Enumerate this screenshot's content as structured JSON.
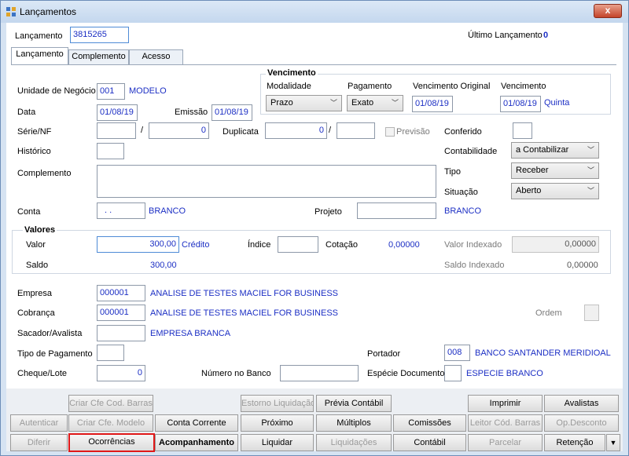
{
  "window": {
    "title": "Lançamentos",
    "close_label": "x"
  },
  "header": {
    "lancamento_label": "Lançamento",
    "lancamento_value": "3815265",
    "ultimo_label": "Último Lançamento",
    "ultimo_value": "0"
  },
  "tabs": [
    "Lançamento",
    "Complemento",
    "Acesso"
  ],
  "form": {
    "unidade_label": "Unidade de Negócio",
    "unidade_code": "001",
    "unidade_name": "MODELO",
    "data_label": "Data",
    "data_value": "01/08/19",
    "emissao_label": "Emissão",
    "emissao_value": "01/08/19",
    "serie_label": "Série/NF",
    "slash": "/",
    "serie_num": "0",
    "duplicata_label": "Duplicata",
    "duplicata_value": "0",
    "previsao_label": "Previsão",
    "historico_label": "Histórico",
    "complemento_label": "Complemento",
    "conta_label": "Conta",
    "conta_value": ". .",
    "conta_name": "BRANCO",
    "projeto_label": "Projeto",
    "projeto_name": "BRANCO"
  },
  "vencimento": {
    "title": "Vencimento",
    "modalidade_label": "Modalidade",
    "modalidade_value": "Prazo",
    "pagamento_label": "Pagamento",
    "pagamento_value": "Exato",
    "venc_original_label": "Vencimento Original",
    "venc_original_value": "01/08/19",
    "venc_label": "Vencimento",
    "venc_value": "01/08/19",
    "venc_day": "Quinta"
  },
  "right": {
    "conferido_label": "Conferido",
    "contabilidade_label": "Contabilidade",
    "contabilidade_value": "a Contabilizar",
    "tipo_label": "Tipo",
    "tipo_value": "Receber",
    "situacao_label": "Situação",
    "situacao_value": "Aberto"
  },
  "valores": {
    "title": "Valores",
    "valor_label": "Valor",
    "valor_value": "300,00",
    "valor_tipo": "Crédito",
    "indice_label": "Índice",
    "cotacao_label": "Cotação",
    "cotacao_value": "0,00000",
    "valor_indexado_label": "Valor Indexado",
    "valor_indexado_value": "0,00000",
    "saldo_label": "Saldo",
    "saldo_value": "300,00",
    "saldo_indexado_label": "Saldo Indexado",
    "saldo_indexado_value": "0,00000"
  },
  "bottom": {
    "empresa_label": "Empresa",
    "empresa_code": "000001",
    "empresa_name": "ANALISE DE TESTES MACIEL FOR BUSINESS",
    "cobranca_label": "Cobrança",
    "cobranca_code": "000001",
    "cobranca_name": "ANALISE DE TESTES MACIEL FOR BUSINESS",
    "ordem_label": "Ordem",
    "sacador_label": "Sacador/Avalista",
    "sacador_name": "EMPRESA BRANCA",
    "tipo_pag_label": "Tipo de Pagamento",
    "portador_label": "Portador",
    "portador_code": "008",
    "portador_name": "BANCO SANTANDER MERIDIOAL",
    "cheque_label": "Cheque/Lote",
    "cheque_value": "0",
    "numero_banco_label": "Número no Banco",
    "especie_label": "Espécie Documento",
    "especie_name": "ESPECIE BRANCO"
  },
  "buttons": {
    "criar_barras": "Criar Cfe Cod. Barras",
    "estorno": "Estorno Liquidação",
    "previa": "Prévia Contábil",
    "imprimir": "Imprimir",
    "avalistas": "Avalistas",
    "autenticar": "Autenticar",
    "criar_modelo": "Criar Cfe. Modelo",
    "conta_corrente": "Conta Corrente",
    "proximo": "Próximo",
    "multiplos": "Múltiplos",
    "comissoes": "Comissões",
    "leitor": "Leitor Cód. Barras",
    "op_desconto": "Op.Desconto",
    "diferir": "Diferir",
    "ocorrencias": "Ocorrências",
    "acompanhamento": "Acompanhamento",
    "liquidar": "Liquidar",
    "liquidacoes": "Liquidações",
    "contabil": "Contábil",
    "parcelar": "Parcelar",
    "retencao": "Retenção",
    "more": "▼"
  }
}
